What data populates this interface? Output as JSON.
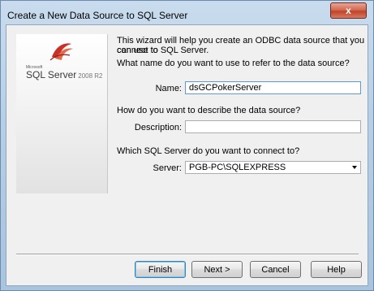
{
  "window": {
    "title": "Create a New Data Source to SQL Server",
    "close_glyph": "x"
  },
  "splash": {
    "brand_small": "Microsoft",
    "brand_product": "SQL Server",
    "brand_version": "2008 R2"
  },
  "intro": {
    "line1": "This wizard will help you create an ODBC data source that you can use to",
    "line2": "connect to SQL Server."
  },
  "name_section": {
    "question": "What name do you want to use to refer to the data source?",
    "label": "Name:",
    "value": "dsGCPokerServer"
  },
  "description_section": {
    "question": "How do you want to describe the data source?",
    "label": "Description:",
    "value": ""
  },
  "server_section": {
    "question": "Which SQL Server do you want to connect to?",
    "label": "Server:",
    "value": "PGB-PC\\SQLEXPRESS"
  },
  "buttons": {
    "finish": "Finish",
    "next": "Next >",
    "cancel": "Cancel",
    "help": "Help"
  }
}
